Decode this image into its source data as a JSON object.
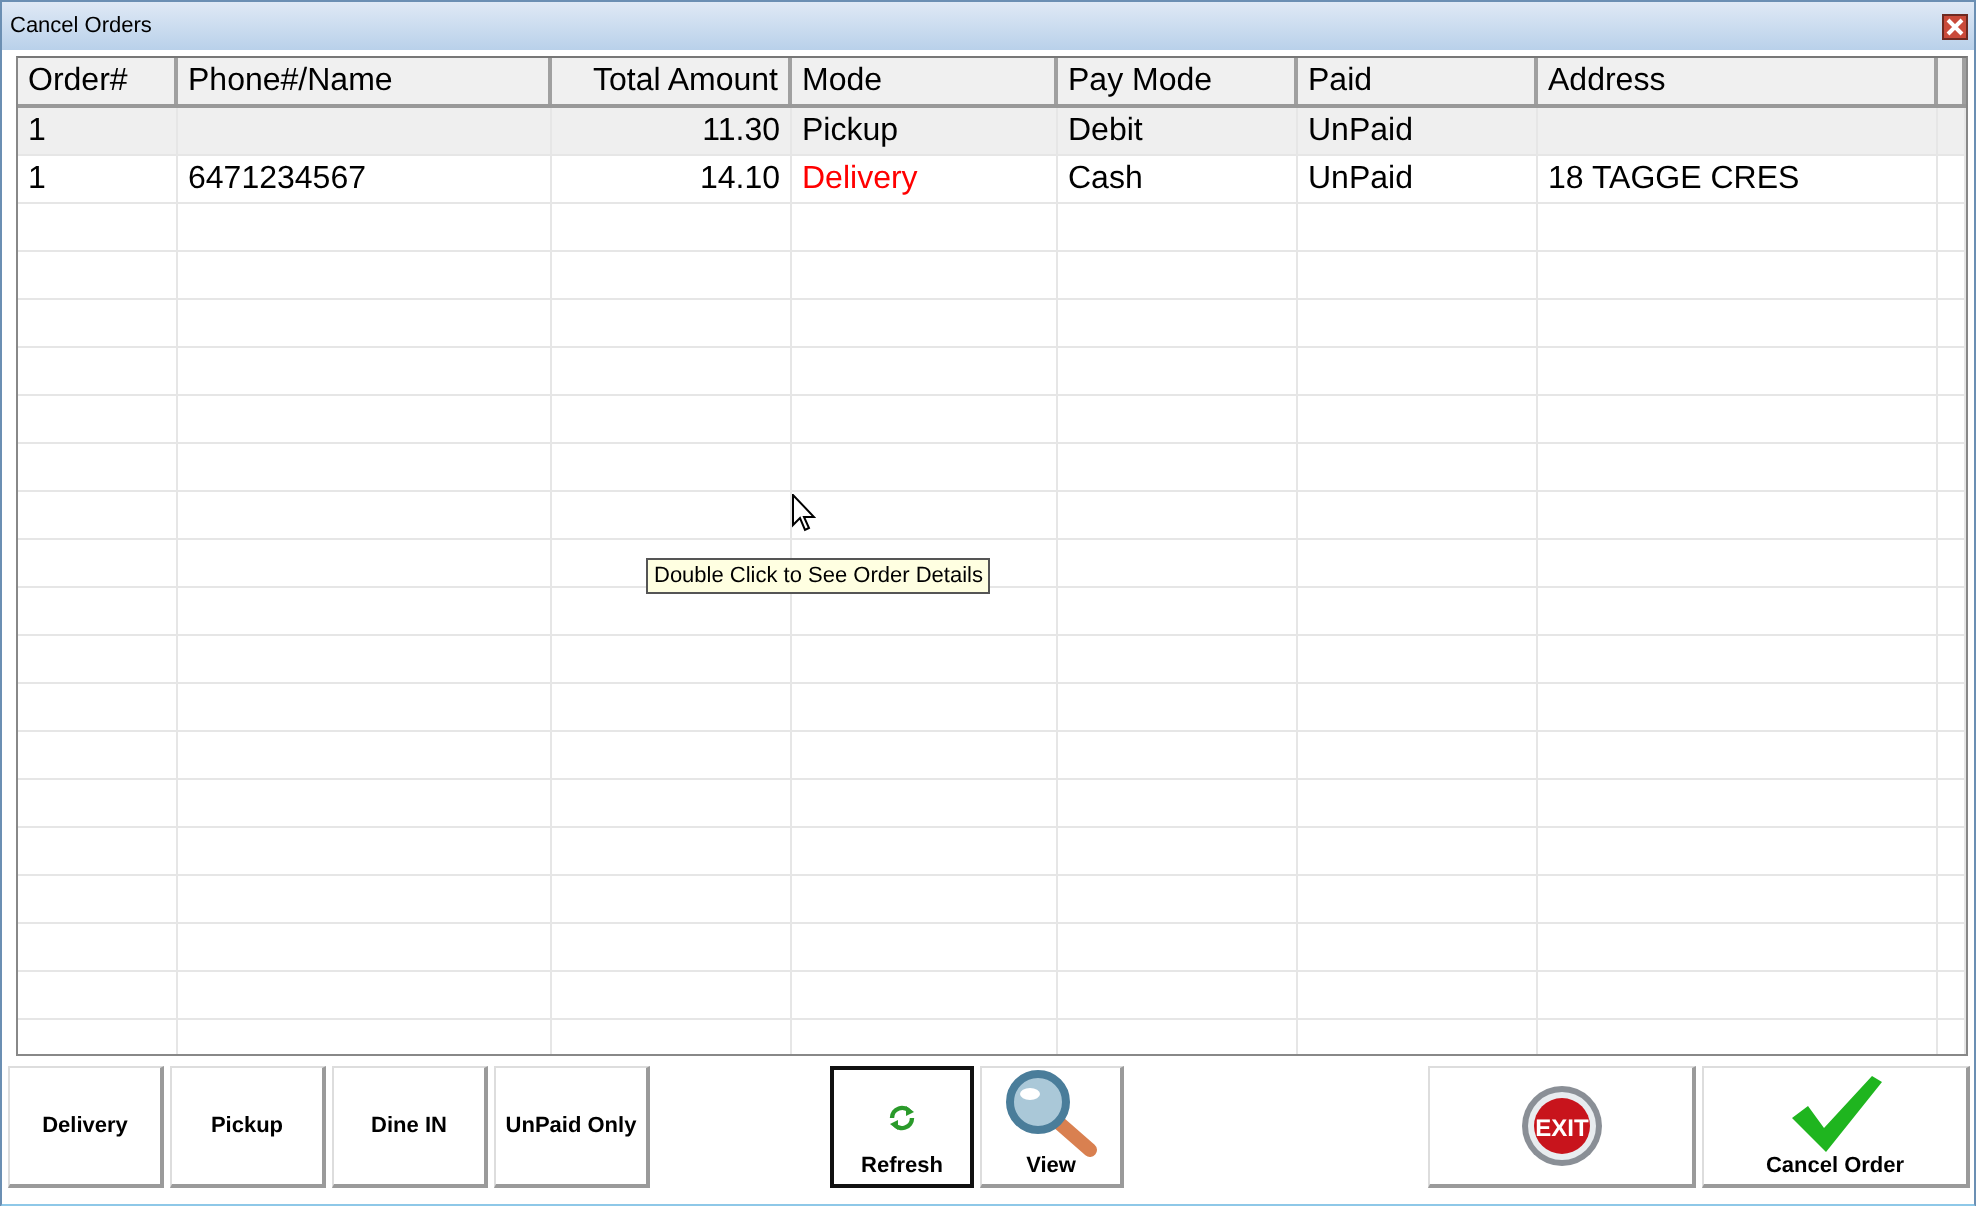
{
  "window": {
    "title": "Cancel Orders"
  },
  "table": {
    "columns": [
      "Order#",
      "Phone#/Name",
      "Total Amount",
      "Mode",
      "Pay Mode",
      "Paid",
      "Address"
    ],
    "rows": [
      {
        "selected": true,
        "cells": [
          "1",
          "",
          "11.30",
          {
            "text": "Pickup",
            "color": "#000000"
          },
          "Debit",
          "UnPaid",
          ""
        ]
      },
      {
        "selected": false,
        "cells": [
          "1",
          "6471234567",
          "14.10",
          {
            "text": "Delivery",
            "color": "#ff0000"
          },
          "Cash",
          "UnPaid",
          "18 TAGGE CRES"
        ]
      }
    ]
  },
  "tooltip": "Double Click to See Order Details",
  "filter_buttons": [
    "Delivery",
    "Pickup",
    "Dine IN",
    "UnPaid Only"
  ],
  "action_buttons": [
    {
      "kind": "refresh",
      "label": "Refresh",
      "focused": true
    },
    {
      "kind": "view",
      "label": "View",
      "focused": false
    }
  ],
  "exit_button": {
    "label": "EXIT"
  },
  "cancel_button": {
    "label": "Cancel Order"
  }
}
